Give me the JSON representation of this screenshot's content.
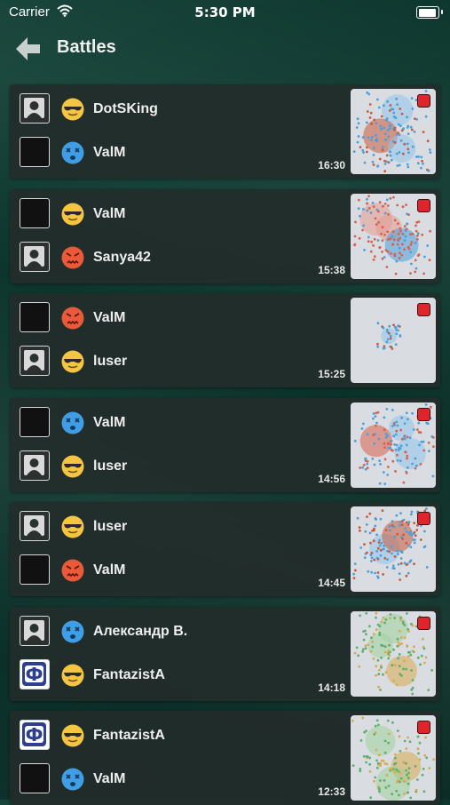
{
  "status_bar": {
    "carrier": "Carrier",
    "time": "5:30 PM"
  },
  "nav": {
    "title": "Battles"
  },
  "battles": [
    {
      "p1": {
        "name": "DotSKing",
        "avatar": "default",
        "mood": "cool"
      },
      "p2": {
        "name": "ValM",
        "avatar": "black",
        "mood": "dead"
      },
      "time": "16:30",
      "map": "blue"
    },
    {
      "p1": {
        "name": "ValM",
        "avatar": "black",
        "mood": "cool"
      },
      "p2": {
        "name": "Sanya42",
        "avatar": "default",
        "mood": "angry"
      },
      "time": "15:38",
      "map": "red"
    },
    {
      "p1": {
        "name": "ValM",
        "avatar": "black",
        "mood": "angry"
      },
      "p2": {
        "name": "luser",
        "avatar": "default",
        "mood": "cool"
      },
      "time": "15:25",
      "map": "sparse"
    },
    {
      "p1": {
        "name": "ValM",
        "avatar": "black",
        "mood": "dead"
      },
      "p2": {
        "name": "luser",
        "avatar": "default",
        "mood": "cool"
      },
      "time": "14:56",
      "map": "mixed"
    },
    {
      "p1": {
        "name": "luser",
        "avatar": "default",
        "mood": "cool"
      },
      "p2": {
        "name": "ValM",
        "avatar": "black",
        "mood": "angry"
      },
      "time": "14:45",
      "map": "blue2"
    },
    {
      "p1": {
        "name": "Александр В.",
        "avatar": "default",
        "mood": "dead"
      },
      "p2": {
        "name": "FantazistA",
        "avatar": "logo",
        "mood": "cool"
      },
      "time": "14:18",
      "map": "green"
    },
    {
      "p1": {
        "name": "FantazistA",
        "avatar": "logo",
        "mood": "cool"
      },
      "p2": {
        "name": "ValM",
        "avatar": "black",
        "mood": "dead"
      },
      "time": "12:33",
      "map": "green2"
    }
  ]
}
